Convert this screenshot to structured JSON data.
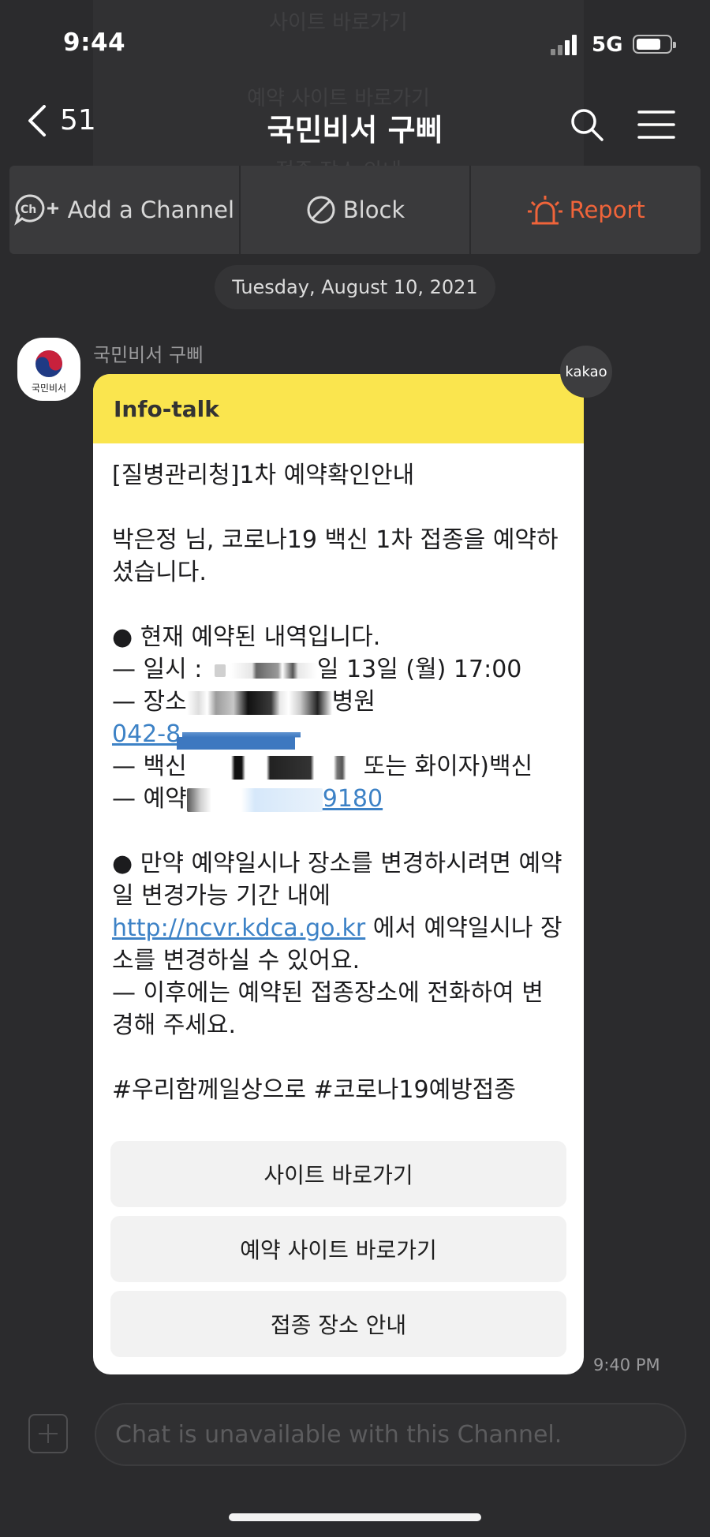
{
  "status": {
    "time": "9:44",
    "network": "5G"
  },
  "header": {
    "back_count": "51",
    "title": "국민비서 구삐"
  },
  "ghost": {
    "line1": "사이트 바로가기",
    "line2": "예약 사이트 바로가기",
    "line3": "접종 장소 안내"
  },
  "actions": {
    "add_channel": "Add a Channel",
    "block": "Block",
    "report": "Report"
  },
  "date": "Tuesday, August 10, 2021",
  "sender": {
    "name": "국민비서 구삐",
    "avatar_text": "국민비서",
    "badge": "kakao"
  },
  "card": {
    "header": "Info-talk",
    "title_line": "[질병관리청]1차 예약확인안내",
    "greeting": "박은정 님, 코로나19 백신 1차 접종을 예약하셨습니다.",
    "current_heading": "● 현재 예약된 내역입니다.",
    "date_prefix": "— 일시 : ",
    "date_suffix": "일 13일 (월) 17:00",
    "place_prefix": "— 장소",
    "place_suffix": "병원",
    "phone_partial": "042-8",
    "vaccine_prefix": "— 백신",
    "vaccine_suffix": "또는 화이자)백신",
    "reservation_prefix": "— 예약",
    "reservation_suffix": "9180",
    "change_heading": "● 만약 예약일시나 장소를 변경하시려면 예약일 변경가능 기간 내에",
    "change_link": "http://ncvr.kdca.go.kr",
    "change_rest": "에서 예약일시나 장소를 변경하실 수 있어요.",
    "after_note": "— 이후에는 예약된 접종장소에 전화하여 변경해 주세요.",
    "hashtags": "#우리함께일상으로 #코로나19예방접종",
    "buttons": [
      "사이트 바로가기",
      "예약 사이트 바로가기",
      "접종 장소 안내"
    ]
  },
  "message_time": "9:40 PM",
  "input": {
    "placeholder": "Chat is unavailable with this Channel."
  },
  "colors": {
    "accent_yellow": "#fae54e",
    "report": "#f0643a",
    "link": "#3d82c6",
    "background": "#2b2b2d"
  }
}
